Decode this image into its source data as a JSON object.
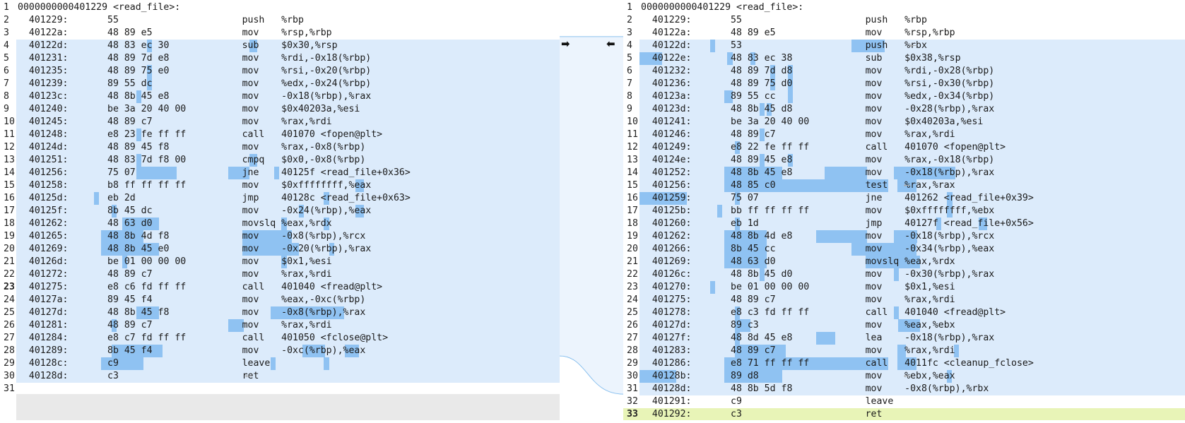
{
  "left": {
    "lines": [
      {
        "n": "1",
        "t": "0000000000401229 <read_file>:",
        "s": "normal"
      },
      {
        "n": "2",
        "t": "  401229:\t55                   \tpush   %rbp",
        "s": "normal"
      },
      {
        "n": "3",
        "t": "  40122a:\t48 89 e5             \tmov    %rsp,%rbp",
        "s": "normal"
      },
      {
        "n": "4",
        "t": "  40122d:\t48 83 ec 30          \tsub    $0x30,%rsp",
        "s": "changed"
      },
      {
        "n": "5",
        "t": "  401231:\t48 89 7d e8          \tmov    %rdi,-0x18(%rbp)",
        "s": "changed"
      },
      {
        "n": "6",
        "t": "  401235:\t48 89 75 e0          \tmov    %rsi,-0x20(%rbp)",
        "s": "changed"
      },
      {
        "n": "7",
        "t": "  401239:\t89 55 dc             \tmov    %edx,-0x24(%rbp)",
        "s": "changed"
      },
      {
        "n": "8",
        "t": "  40123c:\t48 8b 45 e8          \tmov    -0x18(%rbp),%rax",
        "s": "changed"
      },
      {
        "n": "9",
        "t": "  401240:\tbe 3a 20 40 00       \tmov    $0x40203a,%esi",
        "s": "changed"
      },
      {
        "n": "10",
        "t": "  401245:\t48 89 c7             \tmov    %rax,%rdi",
        "s": "changed"
      },
      {
        "n": "11",
        "t": "  401248:\te8 23 fe ff ff       \tcall   401070 <fopen@plt>",
        "s": "changed"
      },
      {
        "n": "12",
        "t": "  40124d:\t48 89 45 f8          \tmov    %rax,-0x8(%rbp)",
        "s": "changed"
      },
      {
        "n": "13",
        "t": "  401251:\t48 83 7d f8 00       \tcmpq   $0x0,-0x8(%rbp)",
        "s": "changed"
      },
      {
        "n": "14",
        "t": "  401256:\t75 07                \tjne    40125f <read_file+0x36>",
        "s": "changed"
      },
      {
        "n": "15",
        "t": "  401258:\tb8 ff ff ff ff       \tmov    $0xffffffff,%eax",
        "s": "changed"
      },
      {
        "n": "16",
        "t": "  40125d:\teb 2d                \tjmp    40128c <read_file+0x63>",
        "s": "changed"
      },
      {
        "n": "17",
        "t": "  40125f:\t8b 45 dc             \tmov    -0x24(%rbp),%eax",
        "s": "changed"
      },
      {
        "n": "18",
        "t": "  401262:\t48 63 d0             \tmovslq %eax,%rdx",
        "s": "changed"
      },
      {
        "n": "19",
        "t": "  401265:\t48 8b 4d f8          \tmov    -0x8(%rbp),%rcx",
        "s": "changed"
      },
      {
        "n": "20",
        "t": "  401269:\t48 8b 45 e0          \tmov    -0x20(%rbp),%rax",
        "s": "changed"
      },
      {
        "n": "21",
        "t": "  40126d:\tbe 01 00 00 00       \tmov    $0x1,%esi",
        "s": "changed"
      },
      {
        "n": "22",
        "t": "  401272:\t48 89 c7             \tmov    %rax,%rdi",
        "s": "changed"
      },
      {
        "n": "23",
        "t": "  401275:\te8 c6 fd ff ff       \tcall   401040 <fread@plt>",
        "s": "changed",
        "bold": true
      },
      {
        "n": "24",
        "t": "  40127a:\t89 45 f4             \tmov    %eax,-0xc(%rbp)",
        "s": "changed"
      },
      {
        "n": "25",
        "t": "  40127d:\t48 8b 45 f8          \tmov    -0x8(%rbp),%rax",
        "s": "changed"
      },
      {
        "n": "26",
        "t": "  401281:\t48 89 c7             \tmov    %rax,%rdi",
        "s": "changed"
      },
      {
        "n": "27",
        "t": "  401284:\te8 c7 fd ff ff       \tcall   401050 <fclose@plt>",
        "s": "changed"
      },
      {
        "n": "28",
        "t": "  401289:\t8b 45 f4             \tmov    -0xc(%rbp),%eax",
        "s": "changed"
      },
      {
        "n": "29",
        "t": "  40128c:\tc9                   \tleave",
        "s": "changed"
      },
      {
        "n": "30",
        "t": "  40128d:\tc3                   \tret",
        "s": "changed"
      },
      {
        "n": "31",
        "t": "",
        "s": "normal"
      }
    ]
  },
  "right": {
    "lines": [
      {
        "n": "1",
        "t": "0000000000401229 <read_file>:",
        "s": "normal"
      },
      {
        "n": "2",
        "t": "  401229:\t55                   \tpush   %rbp",
        "s": "normal"
      },
      {
        "n": "3",
        "t": "  40122a:\t48 89 e5             \tmov    %rsp,%rbp",
        "s": "normal"
      },
      {
        "n": "4",
        "t": "  40122d:\t53                   \tpush   %rbx",
        "s": "changed"
      },
      {
        "n": "5",
        "t": "  40122e:\t48 83 ec 38          \tsub    $0x38,%rsp",
        "s": "changed"
      },
      {
        "n": "6",
        "t": "  401232:\t48 89 7d d8          \tmov    %rdi,-0x28(%rbp)",
        "s": "changed"
      },
      {
        "n": "7",
        "t": "  401236:\t48 89 75 d0          \tmov    %rsi,-0x30(%rbp)",
        "s": "changed"
      },
      {
        "n": "8",
        "t": "  40123a:\t89 55 cc             \tmov    %edx,-0x34(%rbp)",
        "s": "changed"
      },
      {
        "n": "9",
        "t": "  40123d:\t48 8b 45 d8          \tmov    -0x28(%rbp),%rax",
        "s": "changed"
      },
      {
        "n": "10",
        "t": "  401241:\tbe 3a 20 40 00       \tmov    $0x40203a,%esi",
        "s": "changed"
      },
      {
        "n": "11",
        "t": "  401246:\t48 89 c7             \tmov    %rax,%rdi",
        "s": "changed"
      },
      {
        "n": "12",
        "t": "  401249:\te8 22 fe ff ff       \tcall   401070 <fopen@plt>",
        "s": "changed"
      },
      {
        "n": "13",
        "t": "  40124e:\t48 89 45 e8          \tmov    %rax,-0x18(%rbp)",
        "s": "changed"
      },
      {
        "n": "14",
        "t": "  401252:\t48 8b 45 e8          \tmov    -0x18(%rbp),%rax",
        "s": "changed"
      },
      {
        "n": "15",
        "t": "  401256:\t48 85 c0             \ttest   %rax,%rax",
        "s": "changed"
      },
      {
        "n": "16",
        "t": "  401259:\t75 07                \tjne    401262 <read_file+0x39>",
        "s": "changed"
      },
      {
        "n": "17",
        "t": "  40125b:\tbb ff ff ff ff       \tmov    $0xffffffff,%ebx",
        "s": "changed"
      },
      {
        "n": "18",
        "t": "  401260:\teb 1d                \tjmp    40127f <read_file+0x56>",
        "s": "changed"
      },
      {
        "n": "19",
        "t": "  401262:\t48 8b 4d e8          \tmov    -0x18(%rbp),%rcx",
        "s": "changed"
      },
      {
        "n": "20",
        "t": "  401266:\t8b 45 cc             \tmov    -0x34(%rbp),%eax",
        "s": "changed"
      },
      {
        "n": "21",
        "t": "  401269:\t48 63 d0             \tmovslq %eax,%rdx",
        "s": "changed"
      },
      {
        "n": "22",
        "t": "  40126c:\t48 8b 45 d0          \tmov    -0x30(%rbp),%rax",
        "s": "changed"
      },
      {
        "n": "23",
        "t": "  401270:\tbe 01 00 00 00       \tmov    $0x1,%esi",
        "s": "changed"
      },
      {
        "n": "24",
        "t": "  401275:\t48 89 c7             \tmov    %rax,%rdi",
        "s": "changed"
      },
      {
        "n": "25",
        "t": "  401278:\te8 c3 fd ff ff       \tcall   401040 <fread@plt>",
        "s": "changed"
      },
      {
        "n": "26",
        "t": "  40127d:\t89 c3                \tmov    %eax,%ebx",
        "s": "changed"
      },
      {
        "n": "27",
        "t": "  40127f:\t48 8d 45 e8          \tlea    -0x18(%rbp),%rax",
        "s": "changed"
      },
      {
        "n": "28",
        "t": "  401283:\t48 89 c7             \tmov    %rax,%rdi",
        "s": "changed"
      },
      {
        "n": "29",
        "t": "  401286:\te8 71 ff ff ff       \tcall   4011fc <cleanup_fclose>",
        "s": "changed"
      },
      {
        "n": "30",
        "t": "  40128b:\t89 d8                \tmov    %ebx,%eax",
        "s": "changed"
      },
      {
        "n": "31",
        "t": "  40128d:\t48 8b 5d f8          \tmov    -0x8(%rbp),%rbx",
        "s": "changed"
      },
      {
        "n": "32",
        "t": "  401291:\tc9                   \tleave",
        "s": "normal"
      },
      {
        "n": "33",
        "t": "  401292:\tc3                   \tret",
        "s": "added",
        "bold": true
      }
    ]
  },
  "nav": {
    "copy_right_arrow": "➡",
    "copy_left_arrow": "⬅"
  },
  "colors": {
    "changed_bg": "#dcebfb",
    "inline_highlight": "#8fc2f2",
    "added_bg": "#e8f4b7",
    "connector": "#6ab0ea"
  }
}
